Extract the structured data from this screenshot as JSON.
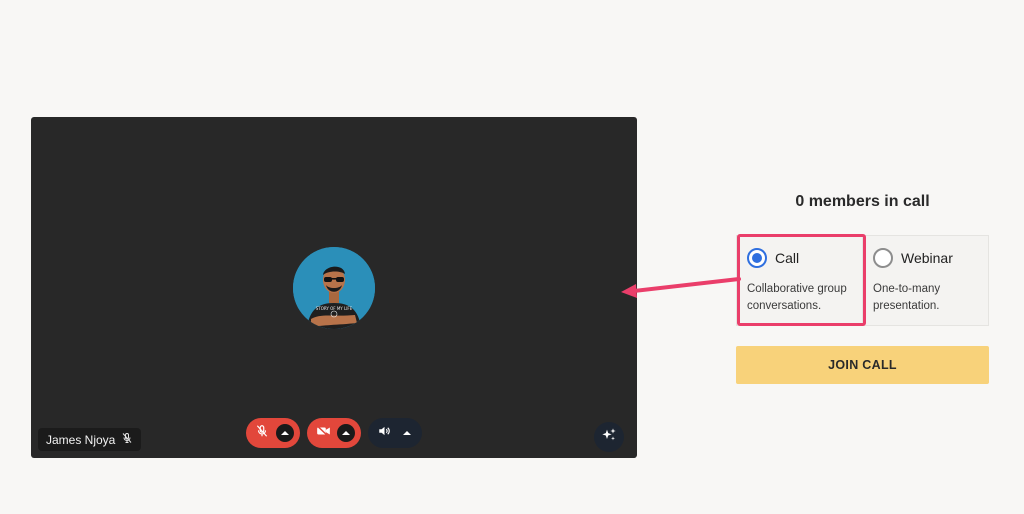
{
  "preview": {
    "participant_name": "James Njoya",
    "avatar_shirt_text": "STORY OF MY LIFE"
  },
  "panel": {
    "members_text": "0 members in call",
    "options": [
      {
        "label": "Call",
        "description": "Collaborative group conversations.",
        "selected": true
      },
      {
        "label": "Webinar",
        "description": "One-to-many presentation.",
        "selected": false
      }
    ],
    "join_label": "JOIN CALL"
  },
  "colors": {
    "preview_bg": "#282828",
    "control_red": "#e2473b",
    "control_dark": "#1d2531",
    "radio_selected": "#2f6fdf",
    "highlight": "#ea3e6a",
    "join_button": "#f8d27a"
  },
  "icons": {
    "name_tag": "mic-off-icon",
    "mic_control": "mic-off-icon",
    "camera_control": "camera-off-icon",
    "speaker_control": "speaker-icon",
    "effects": "sparkles-icon",
    "control_menu": "chevron-up-icon"
  }
}
